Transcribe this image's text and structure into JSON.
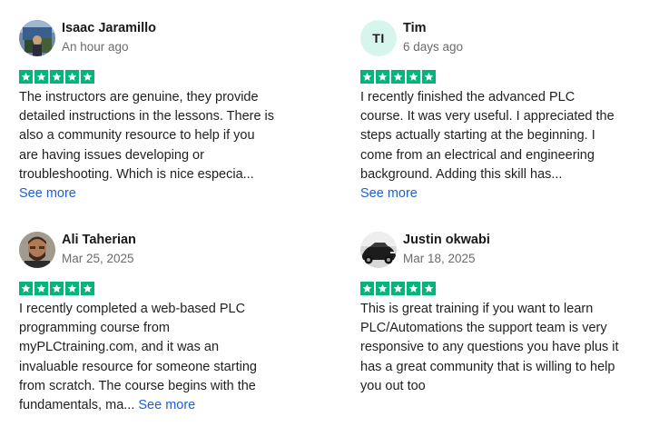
{
  "colors": {
    "star_green": "#00b67a",
    "link_blue": "#1f5fd1",
    "initials_bg": "#d6f5ec"
  },
  "reviews": [
    {
      "name": "Isaac Jaramillo",
      "date": "An hour ago",
      "rating": 5,
      "avatar": "photo",
      "text": "The instructors are genuine, they provide\ndetailed instructions in the lessons. There is\nalso a community resource to help if you\nare having issues developing or\ntroubleshooting. Which is nice especia...",
      "see_more": "See more"
    },
    {
      "name": "Tim",
      "date": "6 days ago",
      "rating": 5,
      "avatar": "initials",
      "initials": "TI",
      "text": "I recently finished the advanced PLC\ncourse. It was very useful. I appreciated the\nsteps actually starting at the beginning. I\ncome from an electrical and engineering\nbackground. Adding this skill has...",
      "see_more": "See more"
    },
    {
      "name": "Ali Taherian",
      "date": "Mar 25, 2025",
      "rating": 5,
      "avatar": "photo",
      "text": "I recently completed a web-based PLC\nprogramming course from\nmyPLCtraining.com, and it was an\ninvaluable resource for someone starting\nfrom scratch. The course begins with the\nfundamentals, ma...",
      "see_more": "See more"
    },
    {
      "name": "Justin okwabi",
      "date": "Mar 18, 2025",
      "rating": 5,
      "avatar": "photo",
      "text": "This is great training if you want to learn\nPLC/Automations the support team is very\nresponsive to any questions you have plus it\nhas a great community that is willing to help\nyou out too"
    }
  ]
}
